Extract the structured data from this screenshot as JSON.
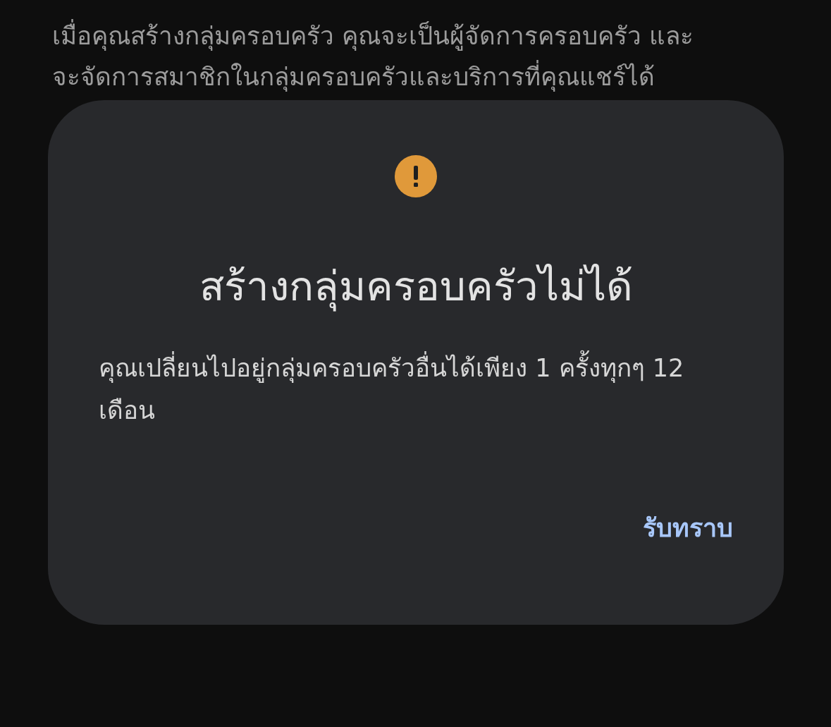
{
  "background_text": {
    "lines": [
      "เมื่อคุณสร้างกลุ่มครอบครัว คุณจะเป็นผู้จัดการครอบครัว และ",
      "จะจัดการสมาชิกในกลุ่มครอบครัวและบริการที่คุณแชร์ได้"
    ]
  },
  "dialog": {
    "title": "สร้างกลุ่มครอบครัวไม่ได้",
    "message": "คุณเปลี่ยนไปอยู่กลุ่มครอบครัวอื่นได้เพียง 1 ครั้งทุกๆ 12 เดือน",
    "buttons": [
      "รับทราบ"
    ]
  }
}
